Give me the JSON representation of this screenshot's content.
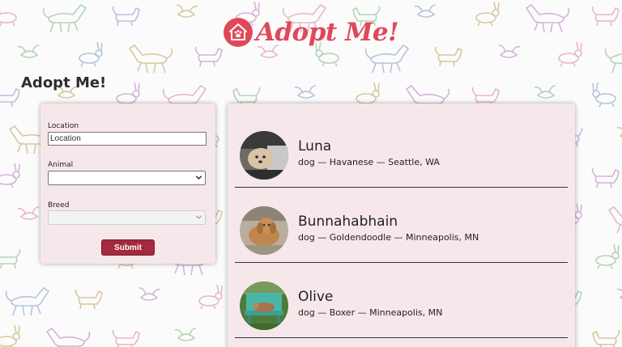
{
  "brand": {
    "logo_text": "Adopt Me!",
    "color": "#e0485a"
  },
  "page": {
    "title": "Adopt Me!"
  },
  "search": {
    "location_label": "Location",
    "location_value": "Location",
    "animal_label": "Animal",
    "animal_value": "",
    "breed_label": "Breed",
    "breed_value": "",
    "submit_label": "Submit",
    "submit_color": "#a3293f"
  },
  "results": [
    {
      "name": "Luna",
      "info": "dog — Havanese — Seattle, WA",
      "photo": "dog-photo"
    },
    {
      "name": "Bunnahabhain",
      "info": "dog — Goldendoodle — Minneapolis, MN",
      "photo": "dog-photo"
    },
    {
      "name": "Olive",
      "info": "dog — Boxer — Minneapolis, MN",
      "photo": "dog-photo"
    }
  ],
  "colors": {
    "card_background": "#f6e8ea",
    "pattern_colors": [
      "#e7b7c6",
      "#b5d3b7",
      "#b4c4dc",
      "#d8c7a0",
      "#d5b3d9"
    ]
  }
}
